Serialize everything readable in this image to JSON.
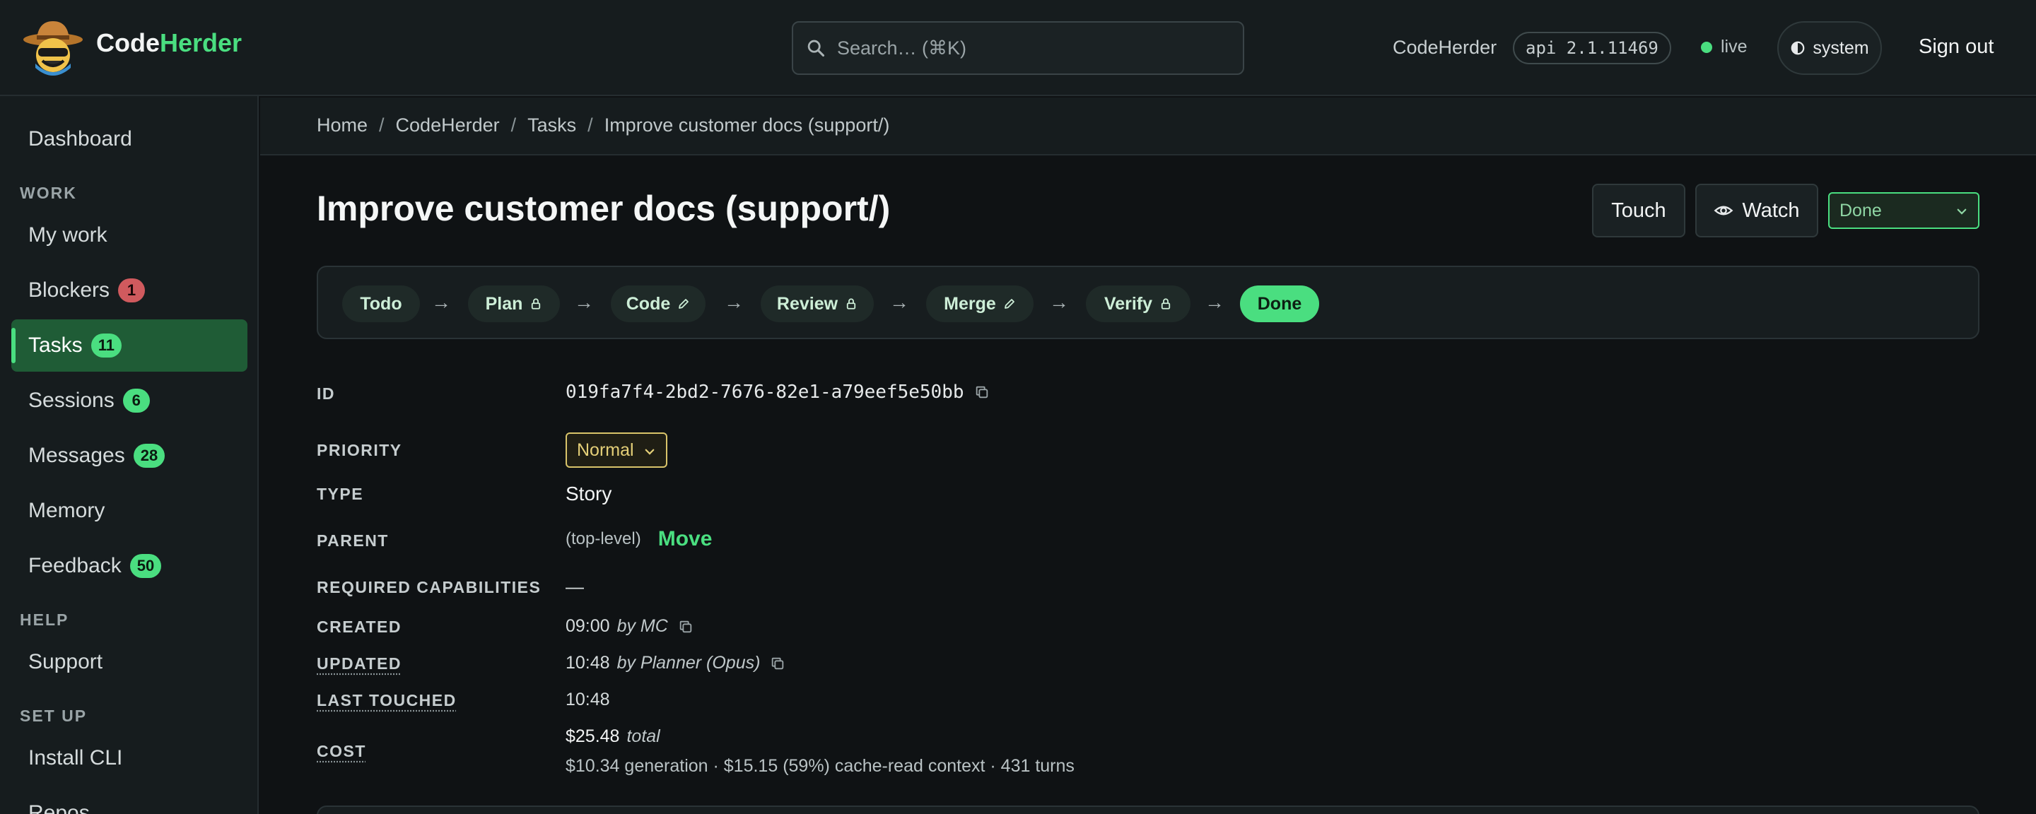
{
  "brand": {
    "name_a": "Code",
    "name_b": "Herder"
  },
  "search": {
    "placeholder": "Search… (⌘K)"
  },
  "header": {
    "app_label": "CodeHerder",
    "api_version": "api 2.1.11469",
    "live_label": "live",
    "theme_label": "system",
    "sign_out": "Sign out"
  },
  "sidebar": {
    "dashboard": "Dashboard",
    "section_work": "WORK",
    "my_work": "My work",
    "blockers": "Blockers",
    "blockers_count": "1",
    "tasks": "Tasks",
    "tasks_count": "11",
    "sessions": "Sessions",
    "sessions_count": "6",
    "messages": "Messages",
    "messages_count": "28",
    "memory": "Memory",
    "feedback": "Feedback",
    "feedback_count": "50",
    "section_help": "HELP",
    "support": "Support",
    "section_setup": "SET UP",
    "install_cli": "Install CLI",
    "repos": "Repos"
  },
  "breadcrumb": {
    "home": "Home",
    "project": "CodeHerder",
    "tasks": "Tasks",
    "current": "Improve customer docs (support/)",
    "sep": "/"
  },
  "task": {
    "title": "Improve customer docs (support/)",
    "touch_label": "Touch",
    "watch_label": "Watch",
    "status": "Done"
  },
  "pipeline": {
    "arrow": "→",
    "steps": [
      {
        "label": "Todo",
        "icon": ""
      },
      {
        "label": "Plan",
        "icon": "lock-icon"
      },
      {
        "label": "Code",
        "icon": "pencil-icon"
      },
      {
        "label": "Review",
        "icon": "lock-icon"
      },
      {
        "label": "Merge",
        "icon": "pencil-icon"
      },
      {
        "label": "Verify",
        "icon": "lock-icon"
      },
      {
        "label": "Done",
        "icon": ""
      }
    ]
  },
  "fields": {
    "id_label": "ID",
    "id_value": "019fa7f4-2bd2-7676-82e1-a79eef5e50bb",
    "priority_label": "PRIORITY",
    "priority_value": "Normal",
    "type_label": "TYPE",
    "type_value": "Story",
    "parent_label": "PARENT",
    "parent_value": "(top-level)",
    "move_label": "Move",
    "capabilities_label": "REQUIRED CAPABILITIES",
    "capabilities_value": "—",
    "created_label": "CREATED",
    "created_time": "09:00",
    "created_by": "by MC",
    "updated_label": "UPDATED",
    "updated_time": "10:48",
    "updated_by": "by Planner (Opus)",
    "touched_label": "LAST TOUCHED",
    "touched_value": "10:48",
    "cost_label": "COST",
    "cost_total": "$25.48",
    "cost_total_suffix": "total",
    "cost_breakdown": "$10.34 generation · $15.15 (59%) cache-read context · 431 turns"
  },
  "colors": {
    "accent": "#4ade80",
    "background": "#0f1214",
    "panel": "#161c1e",
    "danger_badge": "#d05a5e",
    "priority_normal": "#e4cf78"
  }
}
